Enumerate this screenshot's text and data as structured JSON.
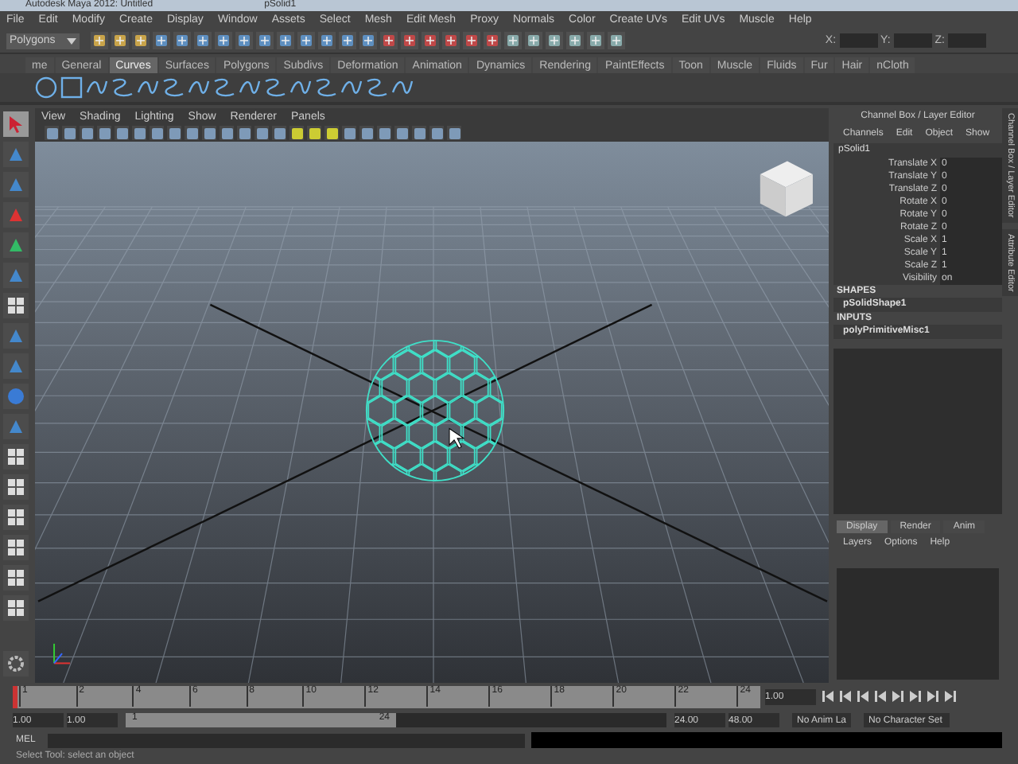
{
  "window": {
    "title": "Autodesk Maya 2012: Untitled",
    "document": "pSolid1"
  },
  "menu_bar": [
    "File",
    "Edit",
    "Modify",
    "Create",
    "Display",
    "Window",
    "Assets",
    "Select",
    "Mesh",
    "Edit Mesh",
    "Proxy",
    "Normals",
    "Color",
    "Create UVs",
    "Edit UVs",
    "Muscle",
    "Help"
  ],
  "status_line": {
    "mode": "Polygons",
    "coord_labels": [
      "X:",
      "Y:",
      "Z:"
    ]
  },
  "shelf_tabs": [
    {
      "label": "me",
      "selected": false
    },
    {
      "label": "General",
      "selected": false
    },
    {
      "label": "Curves",
      "selected": true
    },
    {
      "label": "Surfaces",
      "selected": false
    },
    {
      "label": "Polygons",
      "selected": false
    },
    {
      "label": "Subdivs",
      "selected": false
    },
    {
      "label": "Deformation",
      "selected": false
    },
    {
      "label": "Animation",
      "selected": false
    },
    {
      "label": "Dynamics",
      "selected": false
    },
    {
      "label": "Rendering",
      "selected": false
    },
    {
      "label": "PaintEffects",
      "selected": false
    },
    {
      "label": "Toon",
      "selected": false
    },
    {
      "label": "Muscle",
      "selected": false
    },
    {
      "label": "Fluids",
      "selected": false
    },
    {
      "label": "Fur",
      "selected": false
    },
    {
      "label": "Hair",
      "selected": false
    },
    {
      "label": "nCloth",
      "selected": false
    }
  ],
  "viewport": {
    "menu": [
      "View",
      "Shading",
      "Lighting",
      "Show",
      "Renderer",
      "Panels"
    ]
  },
  "channel_box": {
    "title": "Channel Box / Layer Editor",
    "menu": [
      "Channels",
      "Edit",
      "Object",
      "Show"
    ],
    "object": "pSolid1",
    "attributes": [
      {
        "name": "Translate X",
        "value": "0"
      },
      {
        "name": "Translate Y",
        "value": "0"
      },
      {
        "name": "Translate Z",
        "value": "0"
      },
      {
        "name": "Rotate X",
        "value": "0"
      },
      {
        "name": "Rotate Y",
        "value": "0"
      },
      {
        "name": "Rotate Z",
        "value": "0"
      },
      {
        "name": "Scale X",
        "value": "1"
      },
      {
        "name": "Scale Y",
        "value": "1"
      },
      {
        "name": "Scale Z",
        "value": "1"
      },
      {
        "name": "Visibility",
        "value": "on"
      }
    ],
    "shapes_heading": "SHAPES",
    "shape": "pSolidShape1",
    "inputs_heading": "INPUTS",
    "input": "polyPrimitiveMisc1"
  },
  "side_tabs": [
    "Channel Box / Layer Editor",
    "Attribute Editor"
  ],
  "layer_editor": {
    "tabs": [
      {
        "label": "Display",
        "selected": true
      },
      {
        "label": "Render",
        "selected": false
      },
      {
        "label": "Anim",
        "selected": false
      }
    ],
    "menu": [
      "Layers",
      "Options",
      "Help"
    ]
  },
  "time_slider": {
    "level": 0,
    "start": "1",
    "ticks": [
      "2",
      "4",
      "6",
      "8",
      "10",
      "12",
      "14",
      "16",
      "18",
      "20",
      "22",
      "24"
    ],
    "current_frame": "1.00"
  },
  "range_slider": {
    "level": 0.5,
    "start_time": "1.00",
    "playback_start": "1.00",
    "range_start": "1",
    "range_end": "24",
    "playback_end": "24.00",
    "end_time": "48.00",
    "anim_layer": "No Anim La",
    "character_set": "No Character Set"
  },
  "command_line": {
    "label": "MEL"
  },
  "help_line": "Select Tool: select an object"
}
